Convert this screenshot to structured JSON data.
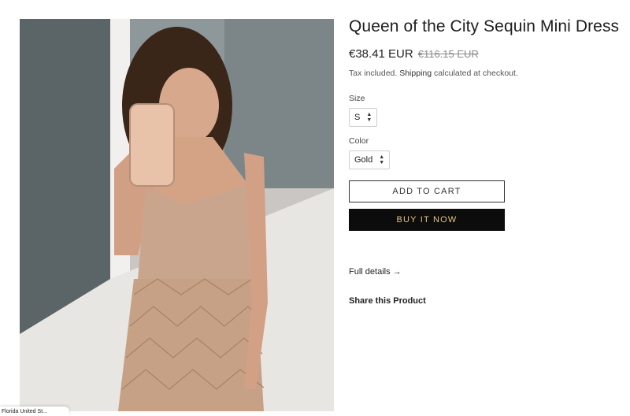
{
  "product": {
    "title": "Queen of the City Sequin Mini Dress",
    "price": "€38.41 EUR",
    "compare_price": "€116.15 EUR",
    "tax_prefix": "Tax included.",
    "tax_link": "Shipping",
    "tax_suffix": "calculated at checkout."
  },
  "options": {
    "size_label": "Size",
    "size_value": "S",
    "color_label": "Color",
    "color_value": "Gold"
  },
  "buttons": {
    "add_to_cart": "ADD TO CART",
    "buy_now": "BUY IT NOW"
  },
  "links": {
    "full_details": "Full details →",
    "share": "Share this Product"
  },
  "badge": {
    "text": "Florida United St..."
  },
  "colors": {
    "buy_bg": "#0c0c0c",
    "buy_text": "#e9c47a",
    "dress": "#caa58e"
  }
}
